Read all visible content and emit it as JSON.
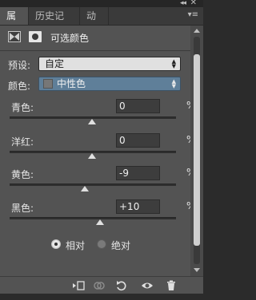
{
  "window": {
    "collapse_glyph": "◂◂",
    "close_glyph": "✕"
  },
  "tabs": [
    {
      "label": "属性",
      "active": true
    },
    {
      "label": "历史记录",
      "active": false
    },
    {
      "label": "动作",
      "active": false
    }
  ],
  "tab_menu_glyph": "▾≡",
  "panel": {
    "title": "可选颜色",
    "preset": {
      "label": "预设:",
      "value": "自定"
    },
    "colors": {
      "label": "颜色:",
      "value": "中性色",
      "swatch": "#777777"
    },
    "sliders": [
      {
        "label": "青色:",
        "value": "0",
        "unit": "%",
        "level": 0
      },
      {
        "label": "洋红:",
        "value": "0",
        "unit": "%",
        "level": 0
      },
      {
        "label": "黄色:",
        "value": "-9",
        "unit": "%",
        "level": -9
      },
      {
        "label": "黑色:",
        "value": "+10",
        "unit": "%",
        "level": 10
      }
    ],
    "method": {
      "relative_label": "相对",
      "absolute_label": "绝对",
      "selected": "relative"
    }
  },
  "bottom_icons": [
    "clip-to-layer-icon",
    "view-previous-state-icon",
    "reset-icon",
    "visibility-eye-icon",
    "trash-icon"
  ]
}
